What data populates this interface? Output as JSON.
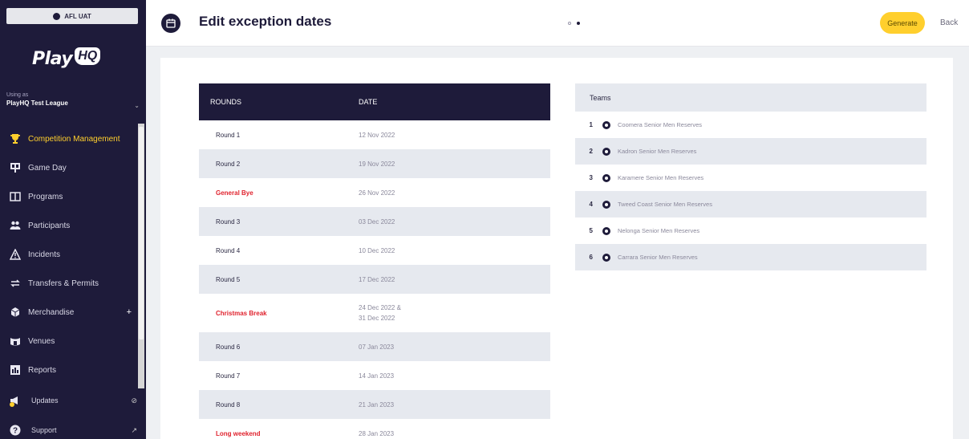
{
  "org": {
    "name": "AFL UAT"
  },
  "brand": {
    "play": "Play",
    "hq": "HQ"
  },
  "using": {
    "label": "Using as",
    "value": "PlayHQ Test League"
  },
  "nav": [
    {
      "label": "Competition Management",
      "icon": "trophy-icon",
      "active": true
    },
    {
      "label": "Game Day",
      "icon": "scoreboard-icon"
    },
    {
      "label": "Programs",
      "icon": "book-icon"
    },
    {
      "label": "Participants",
      "icon": "people-icon"
    },
    {
      "label": "Incidents",
      "icon": "warning-icon"
    },
    {
      "label": "Transfers & Permits",
      "icon": "transfer-icon"
    },
    {
      "label": "Merchandise",
      "icon": "merchandise-icon",
      "extra": "+"
    },
    {
      "label": "Venues",
      "icon": "venue-icon"
    },
    {
      "label": "Reports",
      "icon": "reports-icon"
    }
  ],
  "bottom": {
    "updates": "Updates",
    "support": "Support"
  },
  "header": {
    "title": "Edit exception dates",
    "generate": "Generate",
    "back": "Back"
  },
  "rounds": {
    "col_round": "ROUNDS",
    "col_date": "DATE",
    "rows": [
      {
        "round": "Round 1",
        "date": "12 Nov 2022",
        "date2": ""
      },
      {
        "round": "Round 2",
        "date": "19 Nov 2022",
        "date2": ""
      },
      {
        "round": "General Bye",
        "date": "26 Nov 2022",
        "date2": ""
      },
      {
        "round": "Round 3",
        "date": "03 Dec 2022",
        "date2": ""
      },
      {
        "round": "Round 4",
        "date": "10 Dec 2022",
        "date2": ""
      },
      {
        "round": "Round 5",
        "date": "17 Dec 2022",
        "date2": ""
      },
      {
        "round": "Christmas Break",
        "date": "24 Dec 2022 &",
        "date2": "31 Dec 2022"
      },
      {
        "round": "Round 6",
        "date": "07 Jan 2023",
        "date2": ""
      },
      {
        "round": "Round 7",
        "date": "14 Jan 2023",
        "date2": ""
      },
      {
        "round": "Round 8",
        "date": "21 Jan 2023",
        "date2": ""
      },
      {
        "round": "Long weekend",
        "date": "28 Jan 2023",
        "date2": ""
      }
    ]
  },
  "teams": {
    "header": "Teams",
    "rows": [
      {
        "num": "1",
        "name": "Coomera Senior Men Reserves"
      },
      {
        "num": "2",
        "name": "Kadron Senior Men Reserves"
      },
      {
        "num": "3",
        "name": "Karamere Senior Men Reserves"
      },
      {
        "num": "4",
        "name": "Tweed Coast Senior Men Reserves"
      },
      {
        "num": "5",
        "name": "Nelonga Senior Men Reserves"
      },
      {
        "num": "6",
        "name": "Carrara Senior Men Reserves"
      }
    ]
  },
  "colors": {
    "navy": "#1e1b3a",
    "accent": "#ffcf2d",
    "exception_red": "#e0232e"
  }
}
